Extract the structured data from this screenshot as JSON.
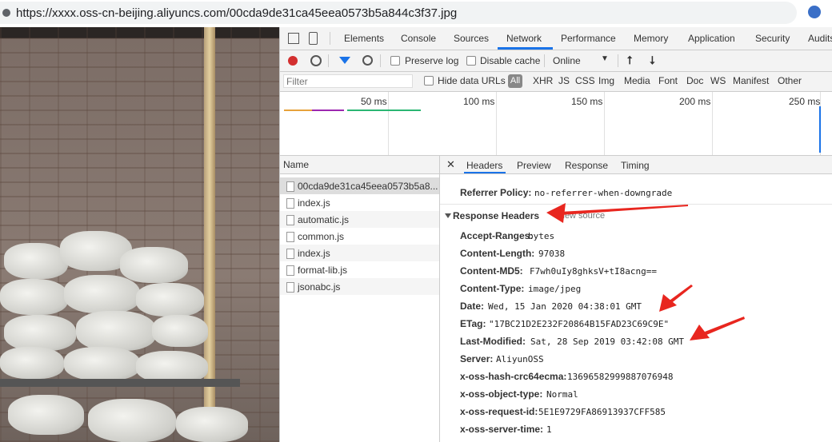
{
  "url": "https://xxxx.oss-cn-beijing.aliyuncs.com/00cda9de31ca45eea0573b5a844c3f37.jpg",
  "devtools_tabs": [
    "Elements",
    "Console",
    "Sources",
    "Network",
    "Performance",
    "Memory",
    "Application",
    "Security",
    "Audits"
  ],
  "active_tab": "Network",
  "toolbar": {
    "preserve_log": "Preserve log",
    "disable_cache": "Disable cache",
    "throttle": "Online"
  },
  "filter": {
    "placeholder": "Filter",
    "hide_data_urls": "Hide data URLs",
    "types": [
      "All",
      "XHR",
      "JS",
      "CSS",
      "Img",
      "Media",
      "Font",
      "Doc",
      "WS",
      "Manifest",
      "Other"
    ]
  },
  "timeline_ticks": [
    "50 ms",
    "100 ms",
    "150 ms",
    "200 ms",
    "250 ms"
  ],
  "request_list": {
    "header": "Name",
    "items": [
      "00cda9de31ca45eea0573b5a8...",
      "index.js",
      "automatic.js",
      "common.js",
      "index.js",
      "format-lib.js",
      "jsonabc.js"
    ]
  },
  "detail_tabs": [
    "Headers",
    "Preview",
    "Response",
    "Timing"
  ],
  "referrer_policy": {
    "key": "Referrer Policy:",
    "value": "no-referrer-when-downgrade"
  },
  "response_headers": {
    "title": "Response Headers",
    "view_source": "view source",
    "items": [
      {
        "key": "Accept-Ranges:",
        "value": "bytes"
      },
      {
        "key": "Content-Length:",
        "value": "97038"
      },
      {
        "key": "Content-MD5:",
        "value": "F7wh0uIy8ghksV+tI8acng=="
      },
      {
        "key": "Content-Type:",
        "value": "image/jpeg"
      },
      {
        "key": "Date:",
        "value": "Wed, 15 Jan 2020 04:38:01 GMT"
      },
      {
        "key": "ETag:",
        "value": "\"17BC21D2E232F20864B15FAD23C69C9E\""
      },
      {
        "key": "Last-Modified:",
        "value": "Sat, 28 Sep 2019 03:42:08 GMT"
      },
      {
        "key": "Server:",
        "value": "AliyunOSS"
      },
      {
        "key": "x-oss-hash-crc64ecma:",
        "value": "13696582999887076948"
      },
      {
        "key": "x-oss-object-type:",
        "value": "Normal"
      },
      {
        "key": "x-oss-request-id:",
        "value": "5E1E9729FA86913937CFF585"
      },
      {
        "key": "x-oss-server-time:",
        "value": "1"
      }
    ]
  },
  "colors": {
    "accent": "#1a73e8",
    "arrow": "#e8261f",
    "record": "#d32f2f"
  }
}
